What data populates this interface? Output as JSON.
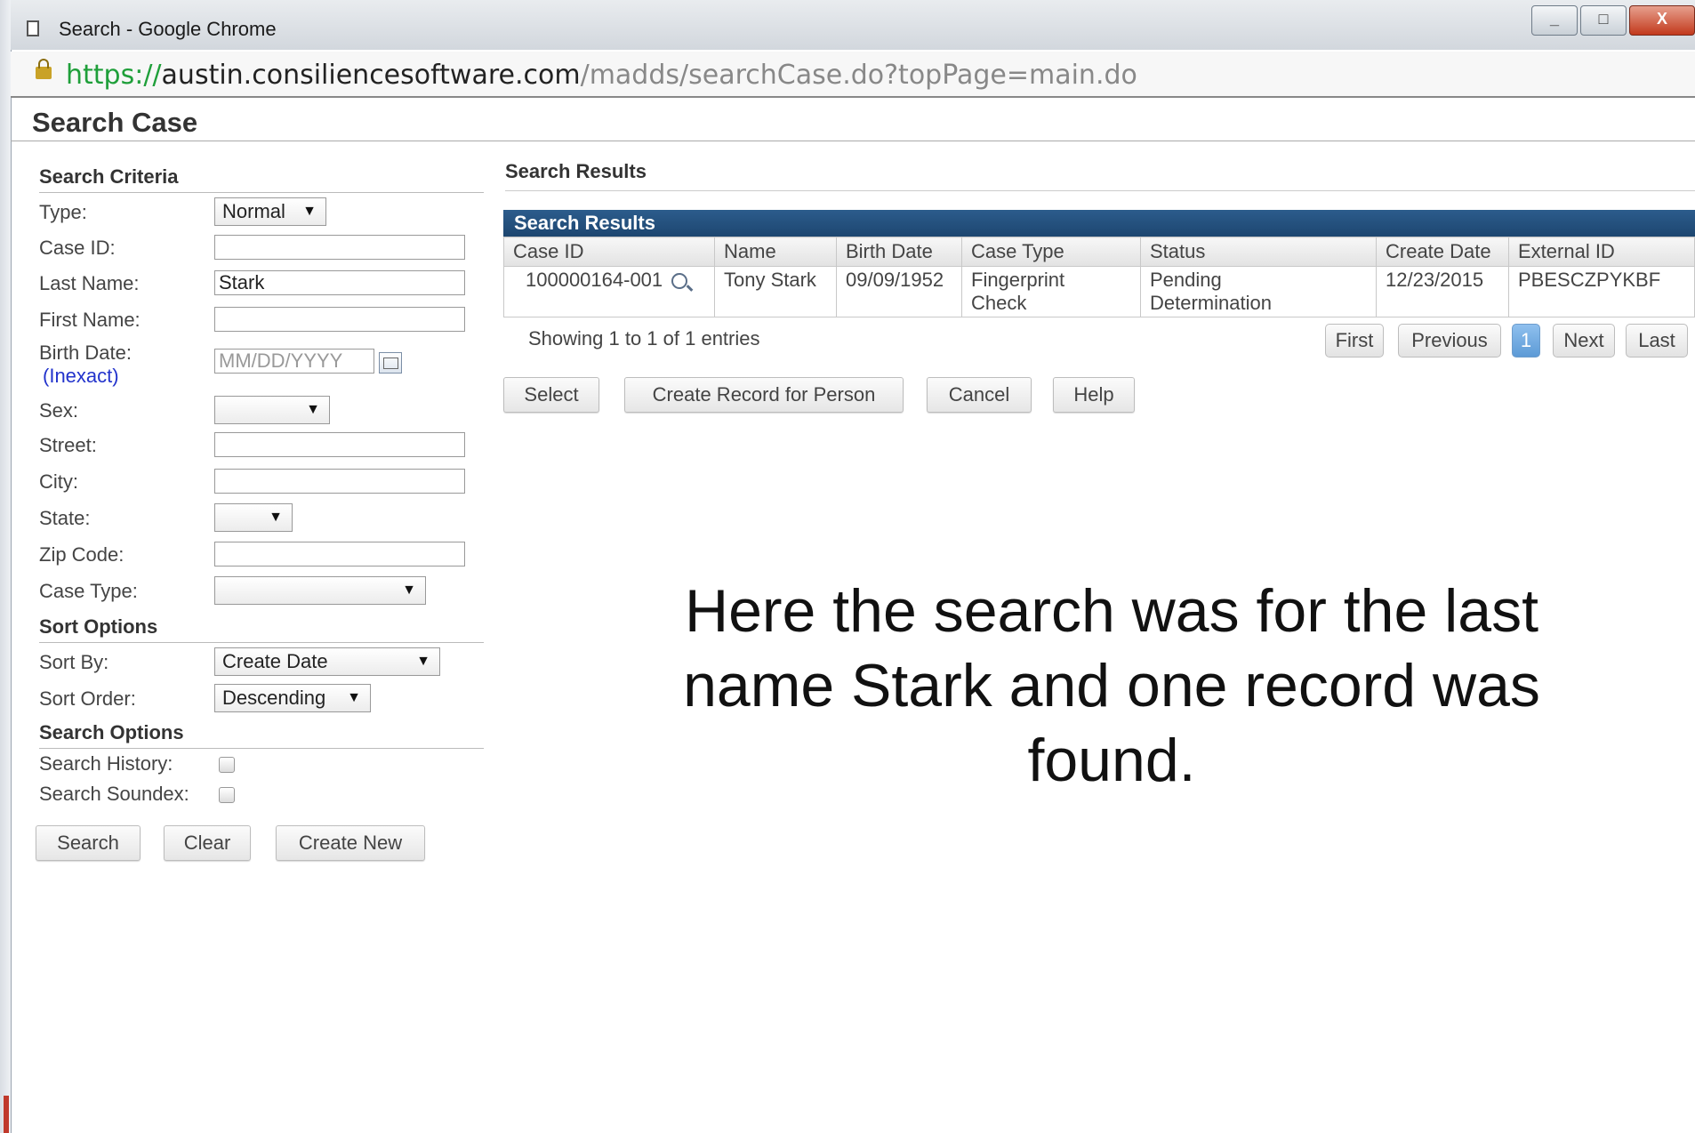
{
  "window": {
    "title": "Search - Google Chrome",
    "controls": {
      "minimize": "_",
      "maximize": "□",
      "close": "X"
    }
  },
  "address": {
    "scheme": "https://",
    "host": "austin.consiliencesoftware.com",
    "path": "/madds/searchCase.do?topPage=main.do"
  },
  "page": {
    "title": "Search Case"
  },
  "criteria": {
    "heading": "Search Criteria",
    "type": {
      "label": "Type:",
      "value": "Normal"
    },
    "case_id": {
      "label": "Case ID:",
      "value": ""
    },
    "last_name": {
      "label": "Last Name:",
      "value": "Stark"
    },
    "first_name": {
      "label": "First Name:",
      "value": ""
    },
    "birth_date": {
      "label": "Birth Date:",
      "inexact": "(Inexact)",
      "placeholder": "MM/DD/YYYY"
    },
    "sex": {
      "label": "Sex:",
      "value": ""
    },
    "street": {
      "label": "Street:",
      "value": ""
    },
    "city": {
      "label": "City:",
      "value": ""
    },
    "state": {
      "label": "State:",
      "value": ""
    },
    "zip": {
      "label": "Zip Code:",
      "value": ""
    },
    "case_type": {
      "label": "Case Type:",
      "value": ""
    }
  },
  "sort": {
    "heading": "Sort Options",
    "by": {
      "label": "Sort By:",
      "value": "Create Date"
    },
    "order": {
      "label": "Sort Order:",
      "value": "Descending"
    }
  },
  "options": {
    "heading": "Search Options",
    "history": {
      "label": "Search History:",
      "checked": false
    },
    "soundex": {
      "label": "Search Soundex:",
      "checked": false
    }
  },
  "left_buttons": {
    "search": "Search",
    "clear": "Clear",
    "create_new": "Create New"
  },
  "results": {
    "heading": "Search Results",
    "banner": "Search Results",
    "columns": [
      "Case ID",
      "Name",
      "Birth Date",
      "Case Type",
      "Status",
      "Create Date",
      "External ID"
    ],
    "rows": [
      {
        "case_id": "100000164-001",
        "name": "Tony Stark",
        "birth_date": "09/09/1952",
        "case_type_1": "Fingerprint",
        "case_type_2": "Check",
        "status_1": "Pending",
        "status_2": "Determination",
        "create_date": "12/23/2015",
        "external_id": "PBESCZPYKBF"
      }
    ],
    "showing": "Showing 1 to 1 of 1 entries",
    "pager": {
      "first": "First",
      "previous": "Previous",
      "current": "1",
      "next": "Next",
      "last": "Last"
    },
    "buttons": {
      "select": "Select",
      "create_record": "Create Record for Person",
      "cancel": "Cancel",
      "help": "Help"
    }
  },
  "caption": {
    "line1": "Here the search was for the last",
    "line2": "name Stark and one record was",
    "line3": "found."
  }
}
